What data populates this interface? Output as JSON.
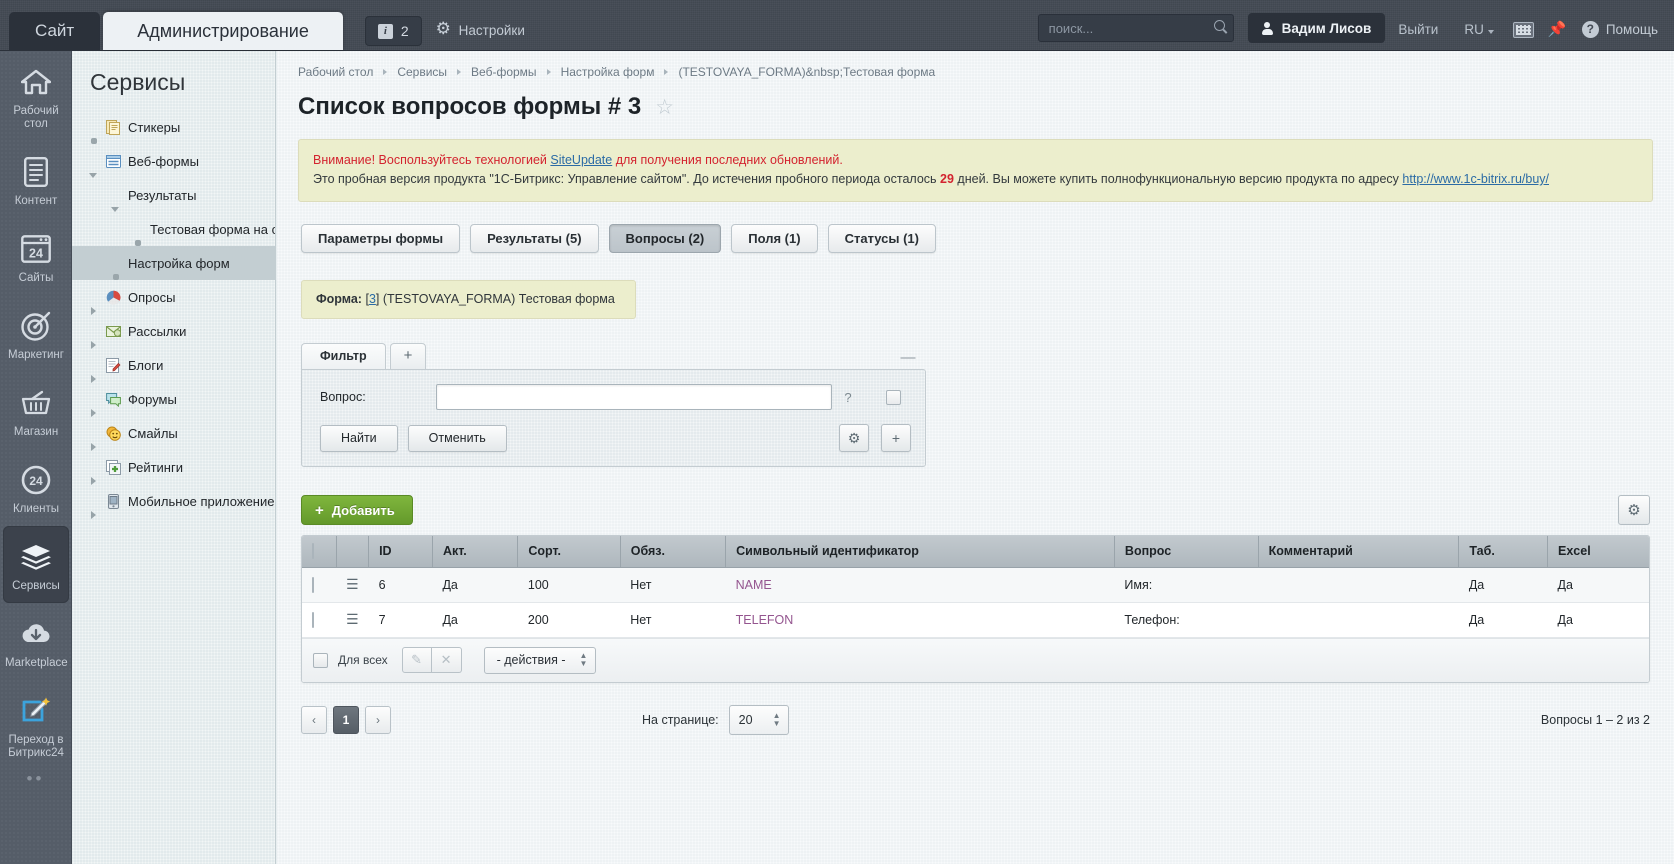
{
  "topbar": {
    "site_tab": "Сайт",
    "admin_tab": "Администрирование",
    "notif_count": "2",
    "notif_icon": "info-icon",
    "settings_label": "Настройки",
    "settings_icon": "gear-icon",
    "search_placeholder": "поиск...",
    "search_value": "",
    "search_icon": "search-icon",
    "user_name": "Вадим Лисов",
    "user_icon": "person-icon",
    "logout_label": "Выйти",
    "lang_label": "RU",
    "keyboard_icon": "keyboard-icon",
    "pin_icon": "pin-icon",
    "help_label": "Помощь",
    "help_icon": "question-circle-icon"
  },
  "rail": {
    "items": [
      {
        "label": "Рабочий стол",
        "icon": "home-icon",
        "active": false
      },
      {
        "label": "Контент",
        "icon": "document-icon",
        "active": false
      },
      {
        "label": "Сайты",
        "icon": "calendar24-icon",
        "active": false
      },
      {
        "label": "Маркетинг",
        "icon": "target-icon",
        "active": false
      },
      {
        "label": "Магазин",
        "icon": "basket-icon",
        "active": false
      },
      {
        "label": "Клиенты",
        "icon": "circle24-icon",
        "active": false
      },
      {
        "label": "Сервисы",
        "icon": "layers-icon",
        "active": true
      },
      {
        "label": "Marketplace",
        "icon": "cloud-download-icon",
        "active": false
      },
      {
        "label": "Переход в Битрикс24",
        "icon": "magic-pencil-icon",
        "active": false
      }
    ],
    "collapse_dots": "••"
  },
  "menu": {
    "title": "Сервисы",
    "items": [
      {
        "label": "Стикеры",
        "arrow": "dot",
        "icon": "stickers-icon",
        "indent": 0,
        "selected": false
      },
      {
        "label": "Веб-формы",
        "arrow": "down",
        "icon": "webform-icon",
        "indent": 0,
        "selected": false
      },
      {
        "label": "Результаты",
        "arrow": "down",
        "icon": "none",
        "indent": 1,
        "selected": false
      },
      {
        "label": "Тестовая форма на стр",
        "arrow": "dot",
        "icon": "none",
        "indent": 2,
        "selected": false
      },
      {
        "label": "Настройка форм",
        "arrow": "dot",
        "icon": "none",
        "indent": 1,
        "selected": true
      },
      {
        "label": "Опросы",
        "arrow": "right",
        "icon": "poll-icon",
        "indent": 0,
        "selected": false
      },
      {
        "label": "Рассылки",
        "arrow": "right",
        "icon": "mail-icon",
        "indent": 0,
        "selected": false
      },
      {
        "label": "Блоги",
        "arrow": "right",
        "icon": "blog-icon",
        "indent": 0,
        "selected": false
      },
      {
        "label": "Форумы",
        "arrow": "right",
        "icon": "forum-icon",
        "indent": 0,
        "selected": false
      },
      {
        "label": "Смайлы",
        "arrow": "right",
        "icon": "smiley-icon",
        "indent": 0,
        "selected": false
      },
      {
        "label": "Рейтинги",
        "arrow": "right",
        "icon": "rating-icon",
        "indent": 0,
        "selected": false
      },
      {
        "label": "Мобильное приложение",
        "arrow": "right",
        "icon": "mobile-icon",
        "indent": 0,
        "selected": false
      }
    ]
  },
  "breadcrumb": [
    "Рабочий стол",
    "Сервисы",
    "Веб-формы",
    "Настройка форм",
    "(TESTOVAYA_FORMA)&nbsp;Тестовая форма"
  ],
  "page": {
    "title": "Список вопросов формы # 3",
    "star_icon": "star-outline-icon"
  },
  "notice": {
    "line1_prefix": "Внимание! Воспользуйтесь технологией ",
    "line1_link": "SiteUpdate",
    "line1_suffix": " для получения последних обновлений.",
    "line2_prefix": "Это пробная версия продукта \"1С-Битрикс: Управление сайтом\". До истечения пробного периода осталось ",
    "line2_days": "29",
    "line2_mid": " дней. Вы можете купить полнофункциональную версию продукта по адресу ",
    "line2_link": "http://www.1c-bitrix.ru/buy/"
  },
  "tabs": [
    {
      "label": "Параметры формы",
      "active": false
    },
    {
      "label": "Результаты (5)",
      "active": false
    },
    {
      "label": "Вопросы (2)",
      "active": true
    },
    {
      "label": "Поля (1)",
      "active": false
    },
    {
      "label": "Статусы (1)",
      "active": false
    }
  ],
  "form_note": {
    "label": "Форма:",
    "id": "3",
    "text": "(TESTOVAYA_FORMA) Тестовая форма"
  },
  "filter": {
    "tab_label": "Фильтр",
    "add_tab_icon": "plus-icon",
    "collapse_icon": "minus-icon",
    "field_label": "Вопрос:",
    "field_value": "",
    "field_placeholder": "",
    "help_icon": "question-mark",
    "checkbox_name": "filter-extra-checkbox",
    "find_label": "Найти",
    "cancel_label": "Отменить",
    "gear_icon": "gear-icon",
    "plus_icon": "plus-icon"
  },
  "toolbar": {
    "add_label": "Добавить",
    "add_icon": "plus-icon",
    "settings_icon": "gear-icon"
  },
  "grid": {
    "columns": [
      "",
      "",
      "ID",
      "Акт.",
      "Сорт.",
      "Обяз.",
      "Символьный идентификатор",
      "Вопрос",
      "Комментарий",
      "Таб.",
      "Excel"
    ],
    "rows": [
      {
        "id": "6",
        "active": "Да",
        "sort": "100",
        "required": "Нет",
        "code": "NAME",
        "question": "Имя:",
        "comment": "",
        "tab": "Да",
        "excel": "Да"
      },
      {
        "id": "7",
        "active": "Да",
        "sort": "200",
        "required": "Нет",
        "code": "TELEFON",
        "question": "Телефон:",
        "comment": "",
        "tab": "Да",
        "excel": "Да"
      }
    ],
    "footer": {
      "for_all_label": "Для всех",
      "edit_icon": "pencil-icon",
      "delete_icon": "close-icon",
      "actions_label": "- действия -"
    }
  },
  "pager": {
    "prev_icon": "chevron-left-icon",
    "current_page": "1",
    "next_icon": "chevron-right-icon",
    "per_page_label": "На странице:",
    "per_page_value": "20",
    "total_text": "Вопросы 1 – 2 из 2"
  }
}
